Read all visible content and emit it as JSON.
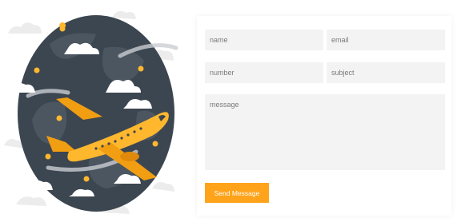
{
  "illustration": {
    "globe_color": "#3c4650",
    "plane_color": "#ffb82e",
    "icons": [
      "globe-icon",
      "airplane-icon",
      "cloud-icon",
      "map-pin-icon"
    ]
  },
  "form": {
    "name_placeholder": "name",
    "email_placeholder": "email",
    "number_placeholder": "number",
    "subject_placeholder": "subject",
    "message_placeholder": "message",
    "send_label": "Send Message",
    "accent_color": "#ffa31a"
  }
}
